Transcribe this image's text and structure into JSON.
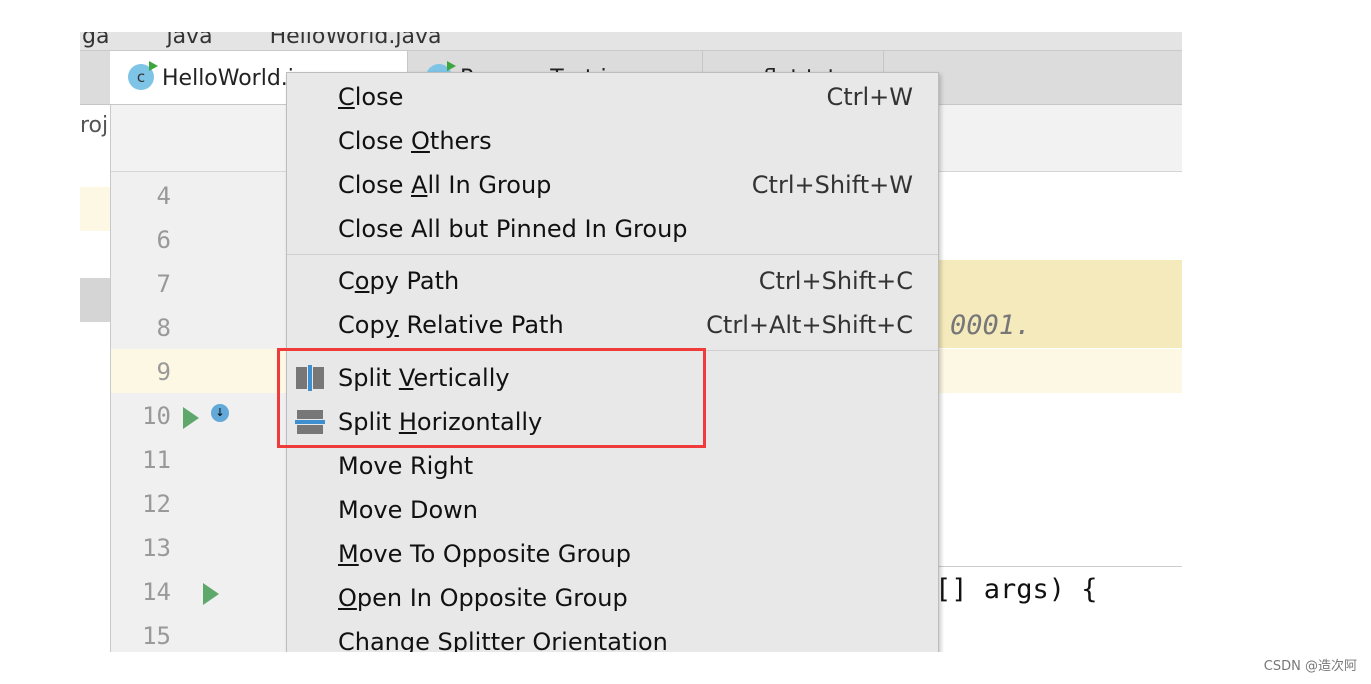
{
  "breadcrumb": [
    "ga",
    "java",
    "HelloWorld.java"
  ],
  "tabs": [
    {
      "label": "HelloWorld.java",
      "active": true
    },
    {
      "label": "RenameTest.java",
      "active": false
    },
    {
      "label": "flat.txt",
      "active": false
    }
  ],
  "left_panel_text": "roj",
  "line_numbers": [
    "4",
    "6",
    "7",
    "8",
    "9",
    "10",
    "11",
    "12",
    "13",
    "14",
    "15"
  ],
  "code_fragments": {
    "line8": "0001.",
    "line14": "[] args) {"
  },
  "context_menu": {
    "groups": [
      [
        {
          "label": "Close",
          "mnemonic": "C",
          "shortcut": "Ctrl+W"
        },
        {
          "label": "Close Others",
          "mnemonic": "O",
          "shortcut": ""
        },
        {
          "label": "Close All In Group",
          "mnemonic": "A",
          "shortcut": "Ctrl+Shift+W"
        },
        {
          "label": "Close All but Pinned In Group",
          "mnemonic": "",
          "shortcut": ""
        }
      ],
      [
        {
          "label": "Copy Path",
          "mnemonic": "o",
          "shortcut": "Ctrl+Shift+C"
        },
        {
          "label": "Copy Relative Path",
          "mnemonic": "y",
          "shortcut": "Ctrl+Alt+Shift+C"
        }
      ],
      [
        {
          "label": "Split Vertically",
          "mnemonic": "V",
          "icon": "split-vertical-icon"
        },
        {
          "label": "Split Horizontally",
          "mnemonic": "H",
          "icon": "split-horizontal-icon"
        },
        {
          "label": "Move Right"
        },
        {
          "label": "Move Down"
        },
        {
          "label": "Move To Opposite Group",
          "mnemonic": "M"
        },
        {
          "label": "Open In Opposite Group",
          "mnemonic": "O"
        },
        {
          "label": "Change Splitter Orientation"
        }
      ]
    ]
  },
  "highlight_color": "#f03b3b",
  "watermark": "CSDN @造次阿"
}
